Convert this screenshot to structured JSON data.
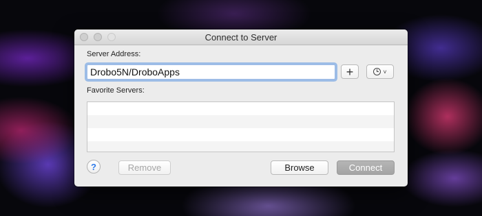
{
  "window": {
    "title": "Connect to Server"
  },
  "server_address": {
    "label": "Server Address:",
    "value": "Drobo5N/DroboApps"
  },
  "buttons": {
    "add_icon": "plus-icon",
    "history_icon": "clock-icon",
    "history_chevron": "˅",
    "add_glyph": "+"
  },
  "favorites": {
    "label": "Favorite Servers:",
    "rows": [
      "",
      "",
      "",
      ""
    ]
  },
  "footer": {
    "help": "?",
    "remove": "Remove",
    "browse": "Browse",
    "connect": "Connect"
  },
  "colors": {
    "focus_ring": "#5b95e2",
    "help_icon": "#2e7bea",
    "connect_bg": "#a9a9a9",
    "window_bg": "#ececec"
  }
}
